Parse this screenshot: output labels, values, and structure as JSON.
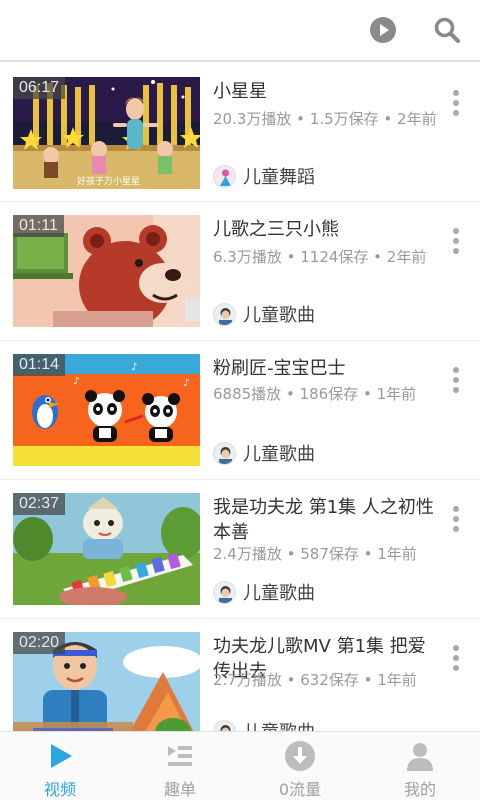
{
  "colors": {
    "accent": "#2aa7e0",
    "icon_gray": "#8a8a8a",
    "tab_gray": "#bdbdbd"
  },
  "header": {
    "icons": [
      "play-circle-icon",
      "search-icon"
    ]
  },
  "videos": [
    {
      "duration": "06:17",
      "title": "小星星",
      "stats": "20.3万播放 • 1.5万保存 • 2年前",
      "channel": "儿童舞蹈",
      "thumb_caption": "好孩子万小星星"
    },
    {
      "duration": "01:11",
      "title": "儿歌之三只小熊",
      "stats": "6.3万播放 • 1124保存 • 2年前",
      "channel": "儿童歌曲"
    },
    {
      "duration": "01:14",
      "title": "粉刷匠-宝宝巴士",
      "stats": "6885播放 • 186保存 • 1年前",
      "channel": "儿童歌曲"
    },
    {
      "duration": "02:37",
      "title": "我是功夫龙 第1集 人之初性本善",
      "stats": "2.4万播放 • 587保存 • 1年前",
      "channel": "儿童歌曲"
    },
    {
      "duration": "02:20",
      "title": "功夫龙儿歌MV 第1集 把爱传出去",
      "stats": "2.7万播放 • 632保存 • 1年前",
      "channel": "儿童歌曲"
    }
  ],
  "tabs": [
    {
      "label": "视频",
      "icon": "play-icon",
      "active": true
    },
    {
      "label": "趣单",
      "icon": "playlist-icon",
      "active": false
    },
    {
      "label": "0流量",
      "icon": "download-icon",
      "active": false
    },
    {
      "label": "我的",
      "icon": "person-icon",
      "active": false
    }
  ]
}
